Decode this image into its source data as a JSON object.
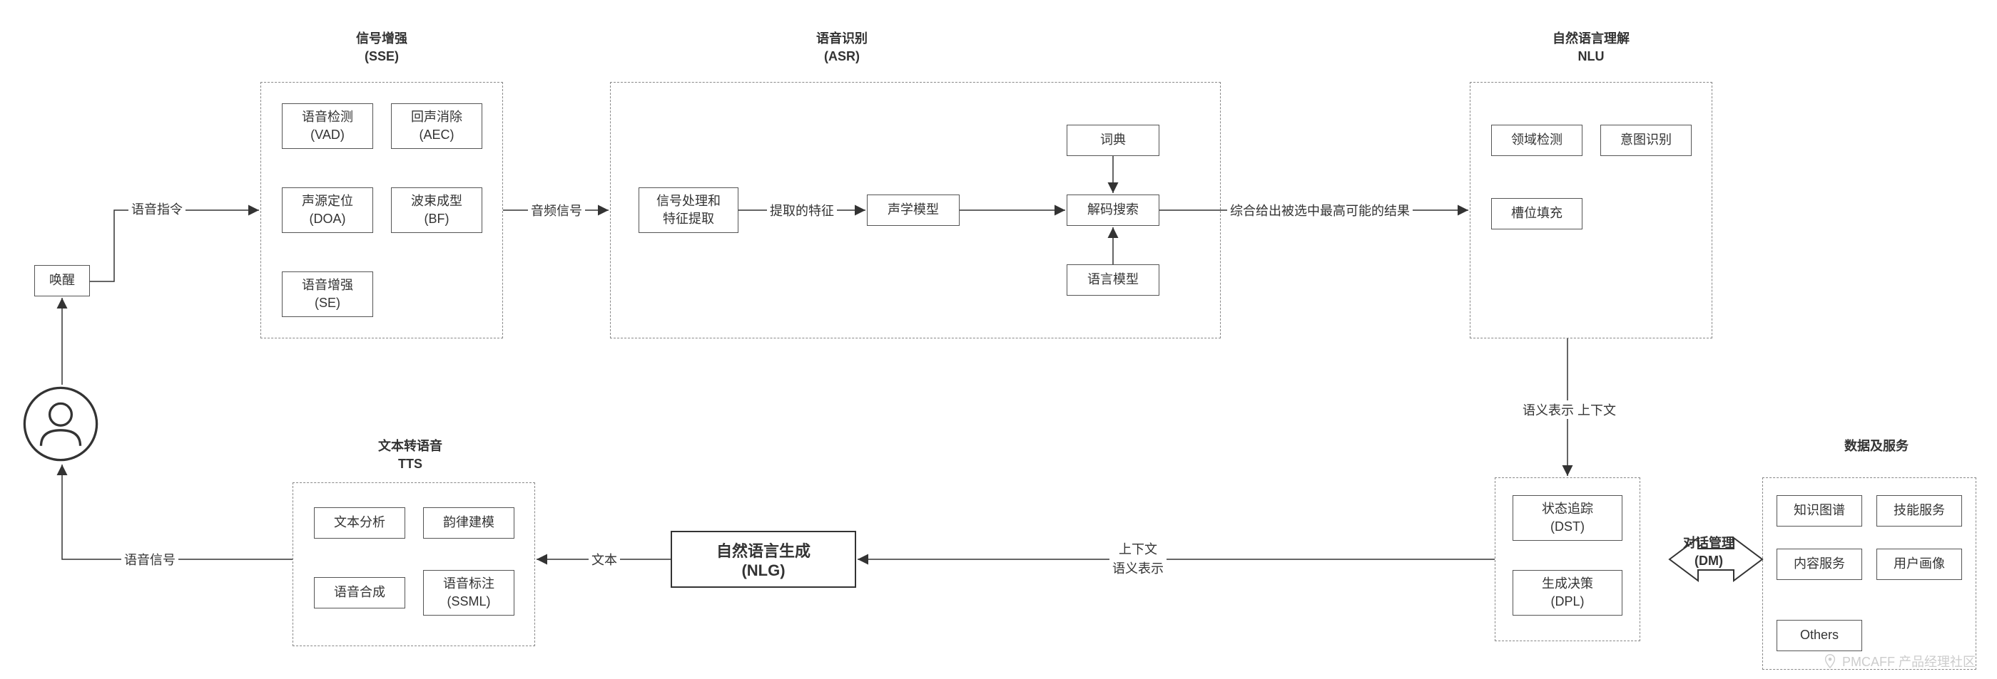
{
  "user_wake": "唤醒",
  "edge_voice_cmd": "语音指令",
  "sse": {
    "title1": "信号增强",
    "title2": "(SSE)",
    "vad1": "语音检测",
    "vad2": "(VAD)",
    "aec1": "回声消除",
    "aec2": "(AEC)",
    "doa1": "声源定位",
    "doa2": "(DOA)",
    "bf1": "波束成型",
    "bf2": "(BF)",
    "se1": "语音增强",
    "se2": "(SE)"
  },
  "edge_audio_signal": "音频信号",
  "asr": {
    "title1": "语音识别",
    "title2": "(ASR)",
    "feat1": "信号处理和",
    "feat2": "特征提取",
    "edge_feat": "提取的特征",
    "am": "声学模型",
    "dict": "词典",
    "decode": "解码搜索",
    "lm": "语言模型"
  },
  "edge_best_result": "综合给出被选中最高可能的结果",
  "nlu": {
    "title1": "自然语言理解",
    "title2": "NLU",
    "domain": "领域检测",
    "intent": "意图识别",
    "slot": "槽位填充"
  },
  "edge_semantic1": "语义表示 上下文",
  "dm": {
    "dst1": "状态追踪",
    "dst2": "(DST)",
    "dpl1": "生成决策",
    "dpl2": "(DPL)",
    "label1": "对话管理",
    "label2": "(DM)"
  },
  "data_services": {
    "title": "数据及服务",
    "kg": "知识图谱",
    "skill": "技能服务",
    "content": "内容服务",
    "profile": "用户画像",
    "others": "Others"
  },
  "edge_ctx1": "上下文",
  "edge_ctx2": "语义表示",
  "nlg": {
    "title1": "自然语言生成",
    "title2": "(NLG)"
  },
  "edge_text": "文本",
  "tts": {
    "title1": "文本转语音",
    "title2": "TTS",
    "ta": "文本分析",
    "prosody": "韵律建模",
    "synth": "语音合成",
    "ssml1": "语音标注",
    "ssml2": "(SSML)"
  },
  "edge_voice_signal": "语音信号",
  "watermark": "PMCAFF 产品经理社区"
}
